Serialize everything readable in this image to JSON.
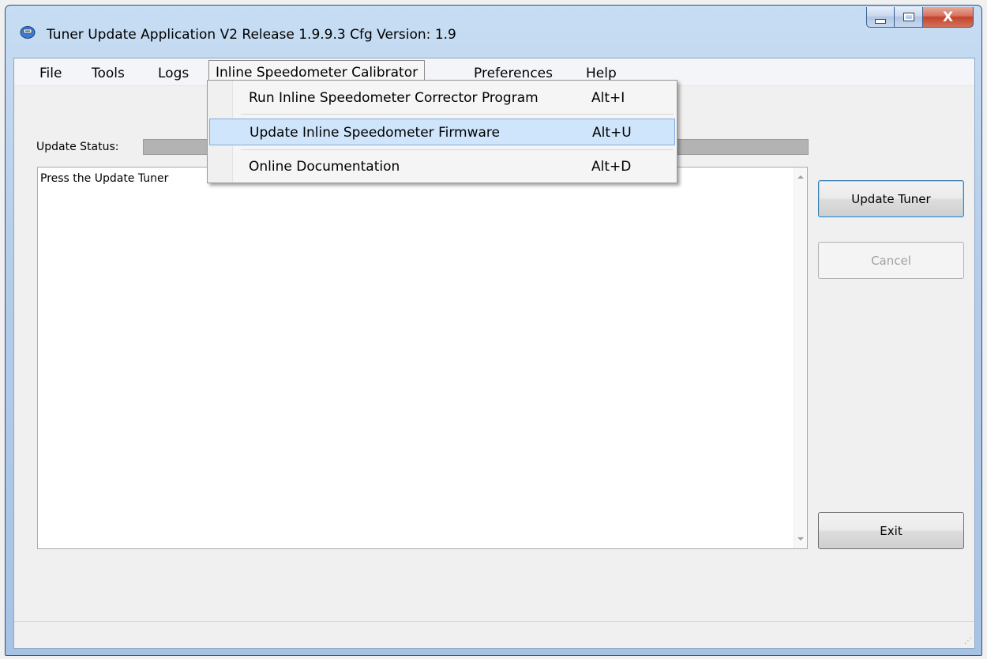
{
  "window": {
    "title": "Tuner Update Application V2 Release 1.9.9.3  Cfg Version: 1.9",
    "close_glyph": "X"
  },
  "menu": {
    "items": [
      "File",
      "Tools",
      "Logs",
      "Inline Speedometer Calibrator",
      "Preferences",
      "Help"
    ],
    "active": "Inline Speedometer Calibrator"
  },
  "dropdown": {
    "items": [
      {
        "label": "Run Inline Speedometer Corrector Program",
        "shortcut": "Alt+I"
      },
      {
        "label": "Update Inline Speedometer Firmware",
        "shortcut": "Alt+U",
        "highlighted": true
      },
      {
        "label": "Online Documentation",
        "shortcut": "Alt+D"
      }
    ]
  },
  "status": {
    "label": "Update Status:"
  },
  "output": {
    "text": "Press the Update Tuner"
  },
  "buttons": {
    "update_tuner": "Update Tuner",
    "cancel": "Cancel",
    "exit": "Exit"
  },
  "colors": {
    "accent": "#cfe5fb",
    "frame": "#b4cde9",
    "close": "#c4432a"
  },
  "icons": [
    "app-icon",
    "minimize-icon",
    "maximize-icon",
    "close-icon",
    "scroll-up-icon",
    "scroll-down-icon",
    "resize-grip-icon"
  ]
}
